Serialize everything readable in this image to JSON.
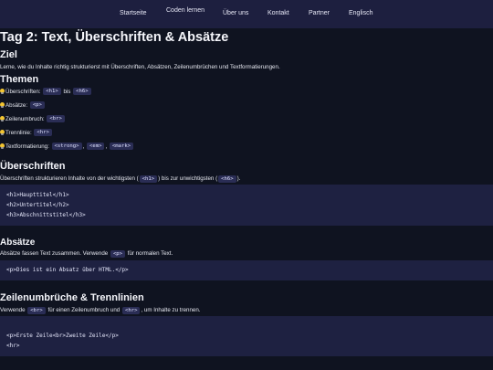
{
  "nav": {
    "items": [
      {
        "label": "Startseite"
      },
      {
        "label": "Coden lernen"
      },
      {
        "label": "Über uns"
      },
      {
        "label": "Kontakt"
      },
      {
        "label": "Partner"
      },
      {
        "label": "Englisch"
      }
    ]
  },
  "title": "Tag 2: Text, Überschriften & Absätze",
  "ziel": {
    "heading": "Ziel",
    "text": "Lerne, wie du Inhalte richtig strukturierst mit Überschriften, Absätzen, Zeilenumbrüchen und Textformatierungen."
  },
  "themen": {
    "heading": "Themen",
    "items": [
      {
        "label": "Überschriften:",
        "codes": [
          "<h1>",
          "<h6>"
        ],
        "joiner": "bis"
      },
      {
        "label": "Absätze:",
        "codes": [
          "<p>"
        ]
      },
      {
        "label": "Zeilenumbruch:",
        "codes": [
          "<br>"
        ]
      },
      {
        "label": "Trennlinie:",
        "codes": [
          "<hr>"
        ]
      },
      {
        "label": "Textformatierung:",
        "codes": [
          "<strong>",
          "<em>",
          "<mark>"
        ],
        "joiner": ","
      }
    ]
  },
  "ueberschriften": {
    "heading": "Überschriften",
    "text_before": "Überschriften strukturieren Inhalte von der wichtigsten (",
    "code1": "<h1>",
    "text_mid": ") bis zur unwichtigsten (",
    "code2": "<h6>",
    "text_after": ").",
    "code_lines": [
      "<h1>Haupttitel</h1>",
      "<h2>Untertitel</h2>",
      "<h3>Abschnittstitel</h3>"
    ]
  },
  "absaetze": {
    "heading": "Absätze",
    "text_before": "Absätze fassen Text zusammen. Verwende",
    "code": "<p>",
    "text_after": "für normalen Text.",
    "code_lines": [
      "<p>Dies ist ein Absatz über HTML.</p>"
    ]
  },
  "umbrueche": {
    "heading": "Zeilenumbrüche & Trennlinien",
    "text_before": "Verwende",
    "code1": "<br>",
    "text_mid": "für einen Zeilenumbruch und",
    "code2": "<hr>",
    "text_after": ", um Inhalte zu trennen.",
    "code_lines": [
      "<p>Erste Zeile<br>Zweite Zeile</p>",
      "<hr>"
    ]
  },
  "colors": {
    "background": "#0f1320",
    "nav_background": "#1d1f3f",
    "code_background": "#2a2d55",
    "block_background": "#1e2141",
    "bulb": "#f3c531"
  }
}
